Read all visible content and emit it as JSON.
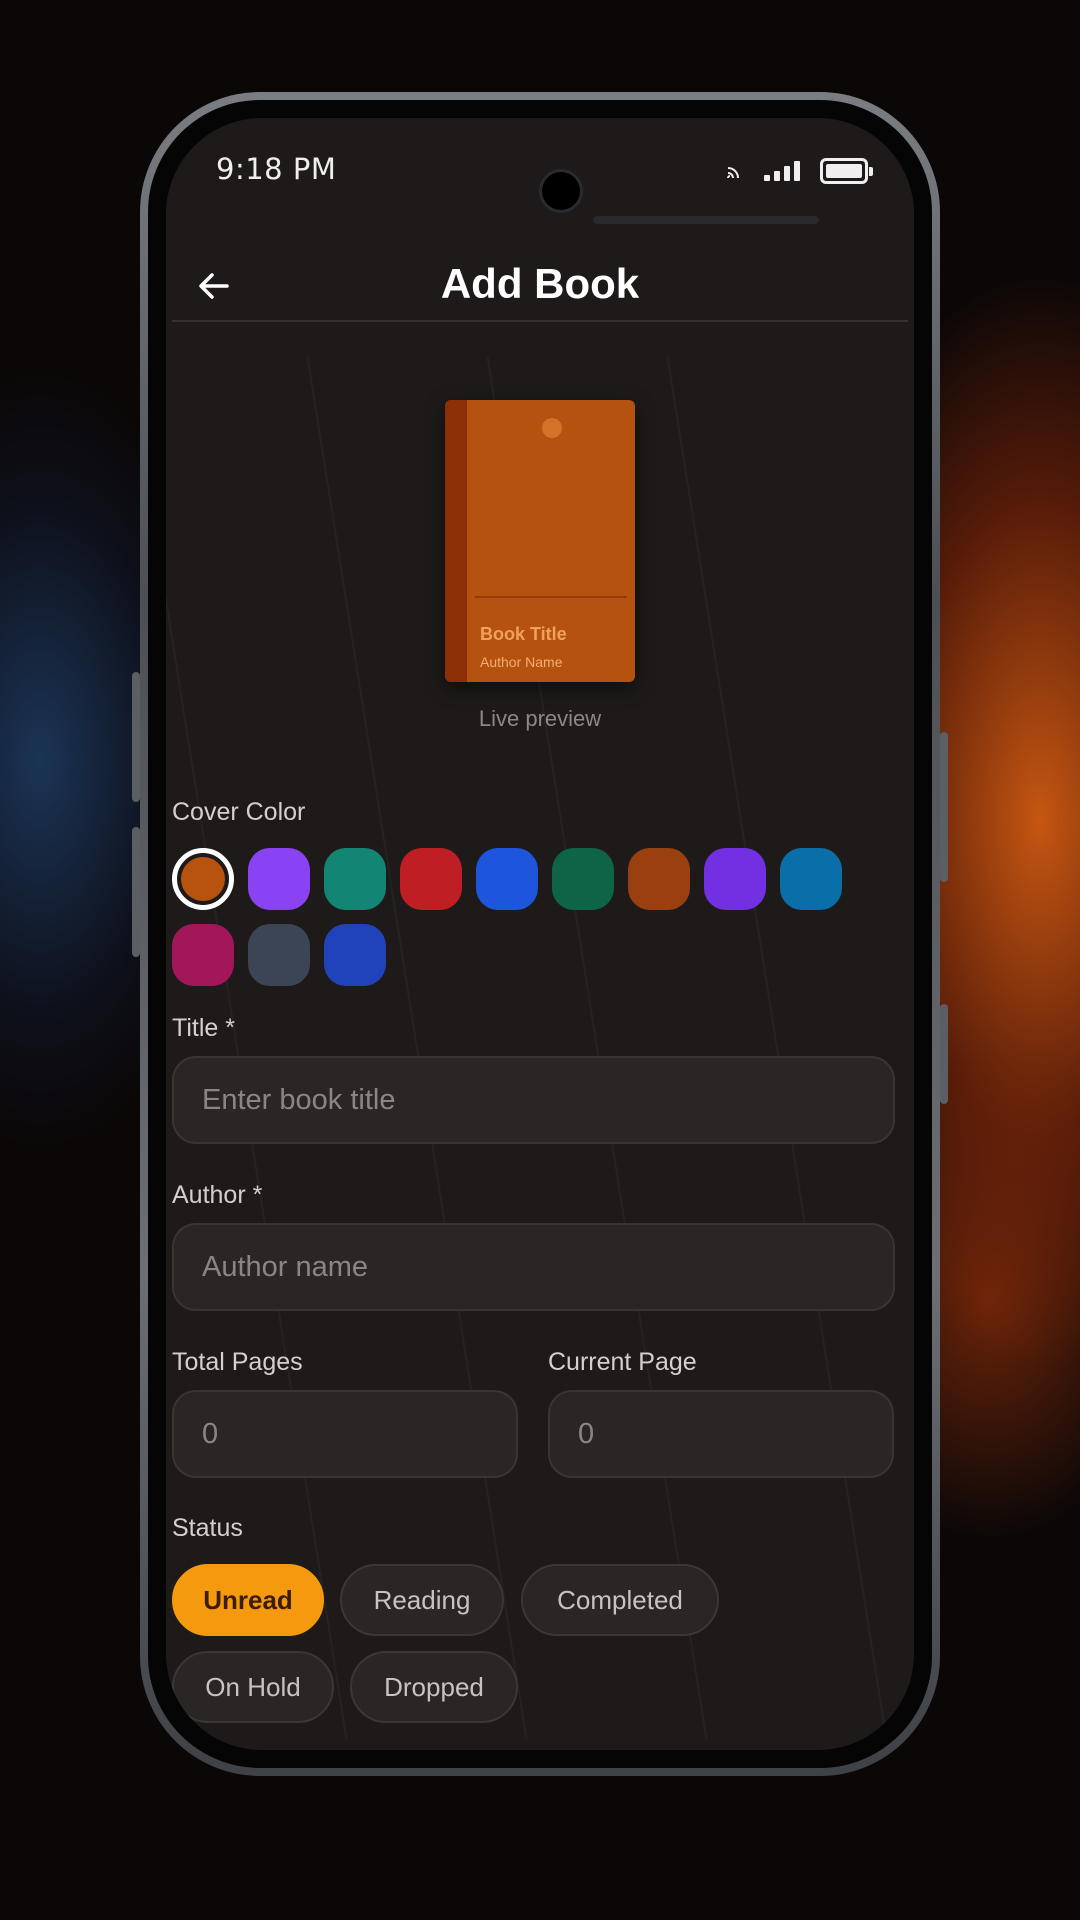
{
  "status_bar": {
    "time": "9:18 PM"
  },
  "header": {
    "title": "Add Book"
  },
  "preview": {
    "book_title": "Book Title",
    "author": "Author Name",
    "caption": "Live preview"
  },
  "cover_color": {
    "label": "Cover Color",
    "selected_index": 0,
    "swatches": [
      "#b8520f",
      "#8a43f2",
      "#138574",
      "#bf1f24",
      "#1d55dc",
      "#0e6447",
      "#9a4010",
      "#7330e2",
      "#0a6fa8",
      "#a4165a",
      "#3c4556",
      "#2042bb"
    ]
  },
  "form": {
    "title": {
      "label": "Title *",
      "placeholder": "Enter book title",
      "value": ""
    },
    "author": {
      "label": "Author *",
      "placeholder": "Author name",
      "value": ""
    },
    "total_pages": {
      "label": "Total Pages",
      "placeholder": "0",
      "value": ""
    },
    "current_page": {
      "label": "Current Page",
      "placeholder": "0",
      "value": ""
    }
  },
  "status": {
    "label": "Status",
    "selected": "Unread",
    "options": [
      "Unread",
      "Reading",
      "Completed",
      "On Hold",
      "Dropped"
    ]
  },
  "colors": {
    "accent": "#f59a0f",
    "background": "#1d1a19",
    "cover": "#b6520f"
  }
}
